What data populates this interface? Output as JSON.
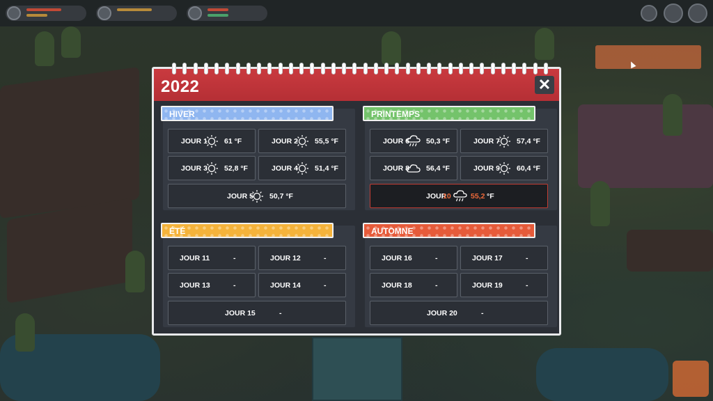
{
  "calendar": {
    "year": "2022",
    "close_label": "✕",
    "seasons": [
      {
        "name": "HIVER",
        "color": "#8fb6f0",
        "days": [
          {
            "day": "JOUR 1",
            "weather": "sun-icon",
            "temp": "61 °F"
          },
          {
            "day": "JOUR 2",
            "weather": "sun-icon",
            "temp": "55,5 °F"
          },
          {
            "day": "JOUR 3",
            "weather": "sun-icon",
            "temp": "52,8 °F"
          },
          {
            "day": "JOUR 4",
            "weather": "sun-icon",
            "temp": "51,4 °F"
          },
          {
            "day": "JOUR 5",
            "weather": "sun-icon",
            "temp": "50,7 °F"
          }
        ]
      },
      {
        "name": "PRINTEMPS",
        "color": "#74c36b",
        "days": [
          {
            "day": "JOUR 6",
            "weather": "rain-cloud-icon",
            "temp": "50,3 °F"
          },
          {
            "day": "JOUR 7",
            "weather": "sun-icon",
            "temp": "57,4 °F"
          },
          {
            "day": "JOUR 8",
            "weather": "cloud-icon",
            "temp": "56,4 °F"
          },
          {
            "day": "JOUR 9",
            "weather": "sun-icon",
            "temp": "60,4 °F"
          },
          {
            "day_label": "JOUR",
            "day_number": "10",
            "weather": "rain-cloud-icon",
            "temp_number": "55,2",
            "temp_unit": "°F",
            "today": true
          }
        ]
      },
      {
        "name": "ÉTÉ",
        "color": "#f5b33b",
        "days": [
          {
            "day": "JOUR 11",
            "temp": "-"
          },
          {
            "day": "JOUR 12",
            "temp": "-"
          },
          {
            "day": "JOUR 13",
            "temp": "-"
          },
          {
            "day": "JOUR 14",
            "temp": "-"
          },
          {
            "day": "JOUR 15",
            "temp": "-"
          }
        ]
      },
      {
        "name": "AUTOMNE",
        "color": "#e65b3a",
        "days": [
          {
            "day": "JOUR 16",
            "temp": "-"
          },
          {
            "day": "JOUR 17",
            "temp": "-"
          },
          {
            "day": "JOUR 18",
            "temp": "-"
          },
          {
            "day": "JOUR 19",
            "temp": "-"
          },
          {
            "day": "JOUR 20",
            "temp": "-"
          }
        ]
      }
    ]
  },
  "colors": {
    "header_red": "#c93a3f",
    "panel_dark": "#2b2f36",
    "today_highlight": "#ef6a3a"
  }
}
